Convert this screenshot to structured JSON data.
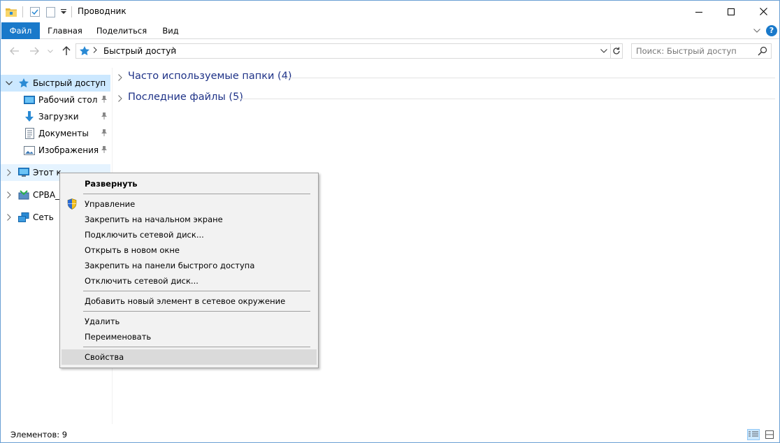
{
  "window": {
    "title": "Проводник"
  },
  "ribbon": {
    "tabs": [
      {
        "label": "Файл"
      },
      {
        "label": "Главная"
      },
      {
        "label": "Поделиться"
      },
      {
        "label": "Вид"
      }
    ],
    "help_label": "?"
  },
  "navbar": {
    "address": "Быстрый доступ",
    "search_placeholder": "Поиск: Быстрый доступ"
  },
  "tree": {
    "items": [
      {
        "label": "Быстрый доступ"
      },
      {
        "label": "Рабочий стол"
      },
      {
        "label": "Загрузки"
      },
      {
        "label": "Документы"
      },
      {
        "label": "Изображения"
      },
      {
        "label": "Этот компьютер"
      },
      {
        "label": "CPBA_Х"
      },
      {
        "label": "Сеть"
      }
    ]
  },
  "content": {
    "groups": [
      {
        "label": "Часто используемые папки (4)"
      },
      {
        "label": "Последние файлы (5)"
      }
    ]
  },
  "status": {
    "items": "Элементов: 9"
  },
  "context_menu": {
    "items": [
      {
        "label": "Развернуть"
      },
      {
        "label": "Управление"
      },
      {
        "label": "Закрепить на начальном экране"
      },
      {
        "label": "Подключить сетевой диск..."
      },
      {
        "label": "Открыть в новом окне"
      },
      {
        "label": "Закрепить на панели быстрого доступа"
      },
      {
        "label": "Отключить сетевой диск..."
      },
      {
        "label": "Добавить новый элемент в сетевое окружение"
      },
      {
        "label": "Удалить"
      },
      {
        "label": "Переименовать"
      },
      {
        "label": "Свойства"
      }
    ]
  },
  "colors": {
    "accent": "#1979ca",
    "selection": "#cce8ff",
    "group_title": "#1e3287"
  }
}
